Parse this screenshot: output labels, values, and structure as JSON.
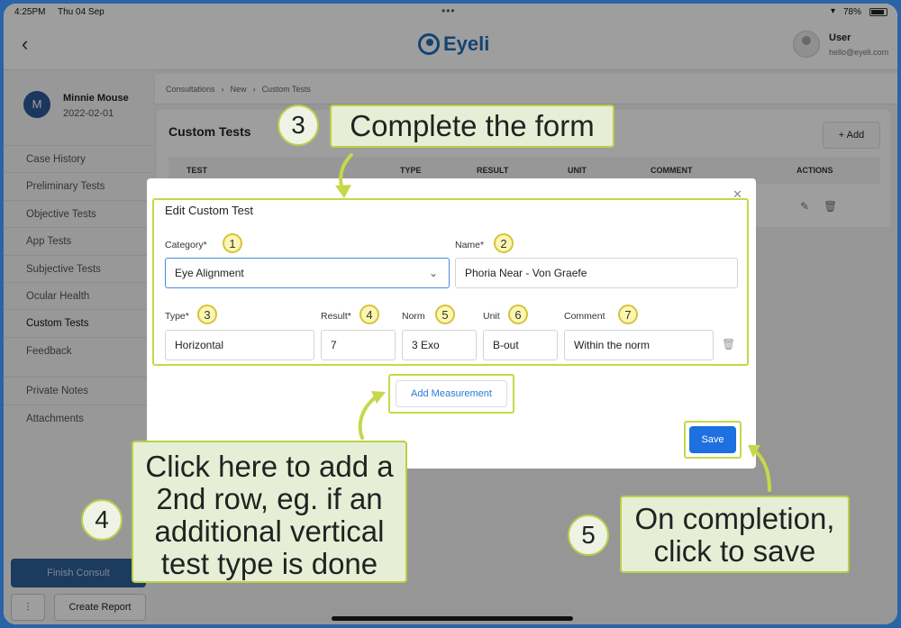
{
  "status_bar": {
    "time": "4:25PM",
    "date": "Thu 04 Sep",
    "dots": "•••",
    "battery": "78%"
  },
  "header": {
    "back_icon": "chevron-left-icon",
    "app_name": "Eyeli",
    "user_name": "User",
    "user_email": "hello@eyeli.com"
  },
  "patient": {
    "initial": "M",
    "name": "Minnie Mouse",
    "dob": "2022-02-01"
  },
  "sidebar": {
    "items": [
      "Case History",
      "Preliminary Tests",
      "Objective Tests",
      "App Tests",
      "Subjective Tests",
      "Ocular Health",
      "Custom Tests",
      "Feedback"
    ],
    "active": "Custom Tests",
    "secondary": [
      "Private Notes",
      "Attachments"
    ],
    "finish_label": "Finish Consult",
    "report_label": "Create Report"
  },
  "breadcrumb": [
    "Consultations",
    "New",
    "Custom Tests"
  ],
  "card": {
    "title": "Custom Tests",
    "add_label": "+ Add",
    "columns": [
      "TEST",
      "TYPE",
      "RESULT",
      "UNIT",
      "COMMENT",
      "ACTIONS"
    ]
  },
  "modal": {
    "title": "Edit Custom Test",
    "category_label": "Category*",
    "category_value": "Eye Alignment",
    "name_label": "Name*",
    "name_value": "Phoria Near - Von Graefe",
    "type_label": "Type*",
    "type_value": "Horizontal",
    "result_label": "Result*",
    "result_value": "7",
    "norm_label": "Norm",
    "norm_value": "3 Exo",
    "unit_label": "Unit",
    "unit_value": "B-out",
    "comment_label": "Comment",
    "comment_value": "Within the norm",
    "add_measurement_label": "Add Measurement",
    "save_label": "Save",
    "badges": [
      "1",
      "2",
      "3",
      "4",
      "5",
      "6",
      "7"
    ]
  },
  "annotations": {
    "step3_number": "3",
    "step3_text": "Complete the form",
    "step4_number": "4",
    "step4_text": "Click here to add a 2nd row, eg. if an additional vertical test type is done",
    "step5_number": "5",
    "step5_text": "On completion, click to save"
  },
  "colors": {
    "brand": "#1f6fb8",
    "highlight": "#c6d84a",
    "callout_bg": "#e6efd6",
    "save": "#1e6fe0"
  }
}
